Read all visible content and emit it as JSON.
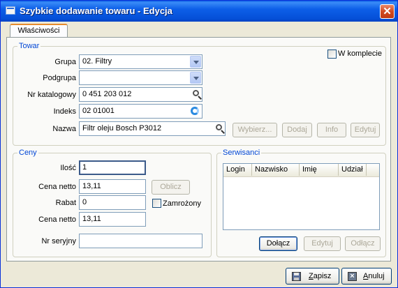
{
  "window": {
    "title": "Szybkie dodawanie towaru - Edycja",
    "close_glyph": "✕"
  },
  "tabs": [
    {
      "label": "Właściwości"
    }
  ],
  "towar": {
    "legend": "Towar",
    "grupa_label": "Grupa",
    "grupa_value": "02. Filtry",
    "podgrupa_label": "Podgrupa",
    "podgrupa_value": "",
    "nr_katalogowy_label": "Nr katalogowy",
    "nr_katalogowy_value": "0 451 203 012",
    "indeks_label": "Indeks",
    "indeks_value": "02 01001",
    "nazwa_label": "Nazwa",
    "nazwa_value": "Filtr oleju Bosch P3012",
    "w_komplecie_label": "W komplecie",
    "w_komplecie_checked": false,
    "buttons": {
      "wybierz": "Wybierz...",
      "dodaj": "Dodaj",
      "info": "Info",
      "edytuj": "Edytuj"
    }
  },
  "ceny": {
    "legend": "Ceny",
    "ilosc_label": "Ilość",
    "ilosc_value": "1",
    "cena_netto_label": "Cena netto",
    "cena_netto_value": "13,11",
    "oblicz_label": "Oblicz",
    "rabat_label": "Rabat",
    "rabat_value": "0",
    "zamrozony_label": "Zamrożony",
    "zamrozony_checked": false,
    "cena_netto2_label": "Cena netto",
    "cena_netto2_value": "13,11",
    "nr_seryjny_label": "Nr seryjny",
    "nr_seryjny_value": ""
  },
  "serwisanci": {
    "legend": "Serwisanci",
    "columns": [
      "Login",
      "Nazwisko",
      "Imię",
      "Udział"
    ],
    "rows": [],
    "buttons": {
      "dolacz": "Dołącz",
      "edytuj": "Edytuj",
      "odlacz": "Odłącz"
    }
  },
  "footer": {
    "zapisz_first": "Z",
    "zapisz_rest": "apisz",
    "anuluj_first": "A",
    "anuluj_rest": "nuluj"
  }
}
